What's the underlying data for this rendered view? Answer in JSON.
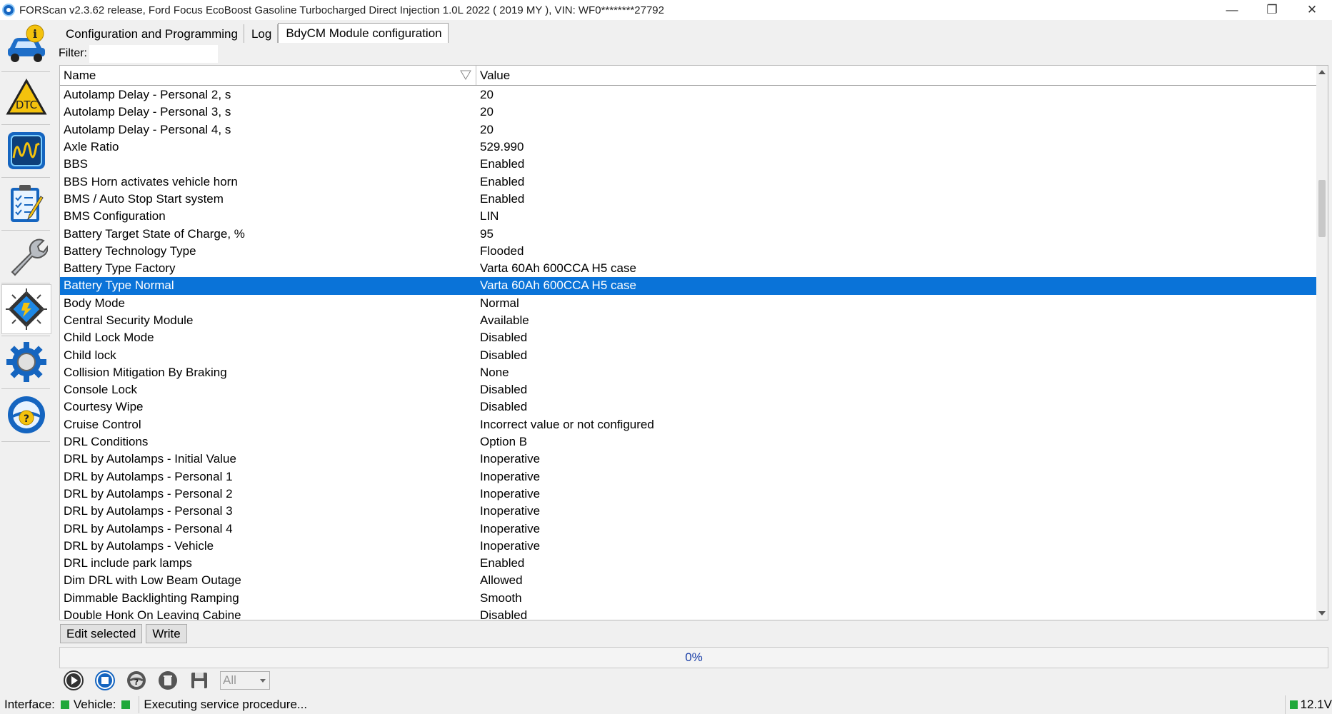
{
  "window": {
    "title": "FORScan v2.3.62 release, Ford Focus EcoBoost Gasoline Turbocharged Direct Injection 1.0L 2022 ( 2019 MY ), VIN: WF0********27792",
    "controls": {
      "minimize": "—",
      "restore": "❐",
      "close": "✕"
    }
  },
  "sidebar": {
    "tools": [
      {
        "name": "vehicle-info-icon"
      },
      {
        "name": "dtc-icon"
      },
      {
        "name": "oscilloscope-icon"
      },
      {
        "name": "checklist-icon"
      },
      {
        "name": "wrench-icon"
      },
      {
        "name": "chip-config-icon"
      },
      {
        "name": "settings-gear-icon"
      },
      {
        "name": "help-steering-icon"
      }
    ]
  },
  "tabs": [
    {
      "label": "Configuration and Programming"
    },
    {
      "label": "Log"
    },
    {
      "label": "BdyCM Module configuration"
    }
  ],
  "filter": {
    "label": "Filter:",
    "value": ""
  },
  "table": {
    "columns": {
      "name": "Name",
      "value": "Value"
    },
    "rows": [
      {
        "name": "Autolamp Delay - Personal 2, s",
        "value": "20"
      },
      {
        "name": "Autolamp Delay - Personal 3, s",
        "value": "20"
      },
      {
        "name": "Autolamp Delay - Personal 4, s",
        "value": "20"
      },
      {
        "name": "Axle Ratio",
        "value": "529.990"
      },
      {
        "name": "BBS",
        "value": "Enabled"
      },
      {
        "name": "BBS Horn activates vehicle horn",
        "value": "Enabled"
      },
      {
        "name": "BMS / Auto Stop Start system",
        "value": "Enabled"
      },
      {
        "name": "BMS Configuration",
        "value": "LIN"
      },
      {
        "name": "Battery Target State of Charge, %",
        "value": "95"
      },
      {
        "name": "Battery Technology Type",
        "value": "Flooded"
      },
      {
        "name": "Battery Type Factory",
        "value": "Varta 60Ah 600CCA H5 case"
      },
      {
        "name": "Battery Type Normal",
        "value": "Varta 60Ah 600CCA H5 case",
        "selected": true
      },
      {
        "name": "Body Mode",
        "value": "Normal"
      },
      {
        "name": "Central Security Module",
        "value": "Available"
      },
      {
        "name": "Child Lock Mode",
        "value": "Disabled"
      },
      {
        "name": "Child lock",
        "value": "Disabled"
      },
      {
        "name": "Collision Mitigation By Braking",
        "value": "None"
      },
      {
        "name": "Console Lock",
        "value": "Disabled"
      },
      {
        "name": "Courtesy Wipe",
        "value": "Disabled"
      },
      {
        "name": "Cruise Control",
        "value": "Incorrect value or not configured"
      },
      {
        "name": "DRL Conditions",
        "value": "Option B"
      },
      {
        "name": "DRL by Autolamps - Initial Value",
        "value": "Inoperative"
      },
      {
        "name": "DRL by Autolamps - Personal 1",
        "value": "Inoperative"
      },
      {
        "name": "DRL by Autolamps - Personal 2",
        "value": "Inoperative"
      },
      {
        "name": "DRL by Autolamps - Personal 3",
        "value": "Inoperative"
      },
      {
        "name": "DRL by Autolamps - Personal 4",
        "value": "Inoperative"
      },
      {
        "name": "DRL by Autolamps - Vehicle",
        "value": "Inoperative"
      },
      {
        "name": "DRL include park lamps",
        "value": "Enabled"
      },
      {
        "name": "Dim DRL with Low Beam Outage",
        "value": "Allowed"
      },
      {
        "name": "Dimmable Backlighting Ramping",
        "value": "Smooth"
      },
      {
        "name": "Double Honk On Leaving Cabine",
        "value": "Disabled"
      }
    ]
  },
  "actions": {
    "edit_label": "Edit selected",
    "write_label": "Write"
  },
  "progress": {
    "text": "0%",
    "fraction": 0
  },
  "bottom_toolbar": {
    "select_value": "All"
  },
  "status": {
    "interface_label": "Interface:",
    "vehicle_label": "Vehicle:",
    "message": "Executing service procedure...",
    "voltage": "12.1V",
    "led_color": "#1fa83a"
  },
  "colors": {
    "selection": "#0a73d8",
    "accent_blue": "#1565c0"
  }
}
